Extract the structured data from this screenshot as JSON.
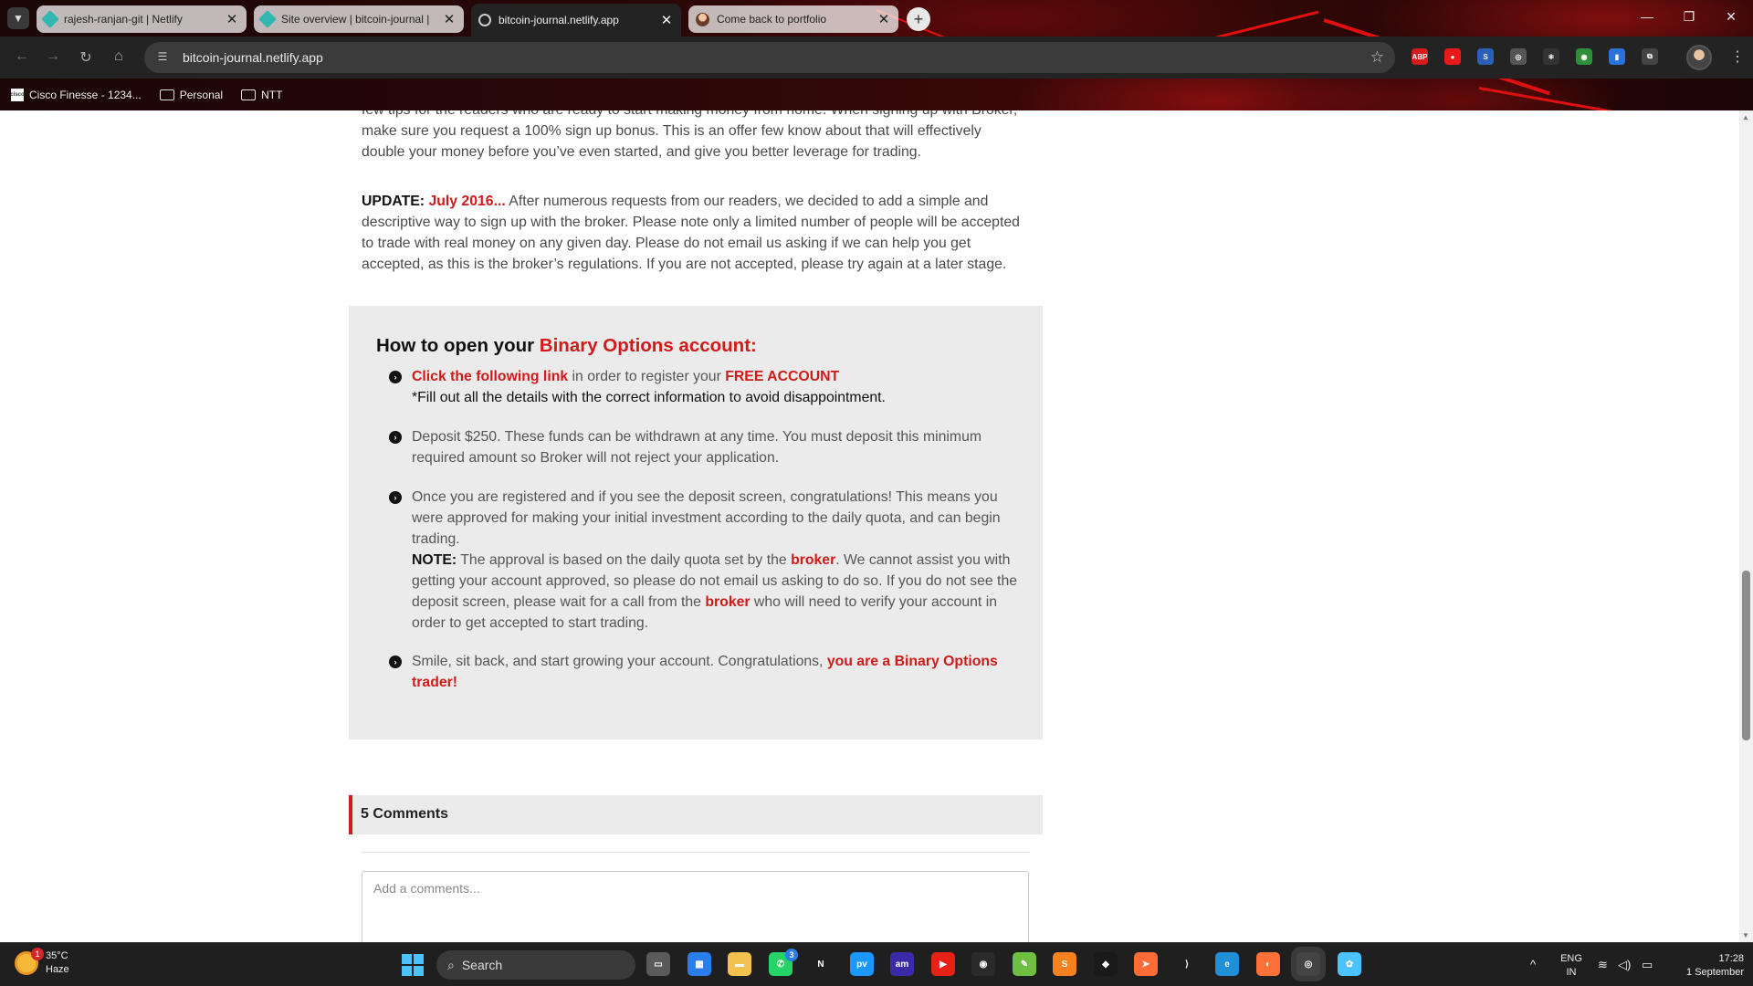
{
  "browser": {
    "tabs": [
      {
        "label": "rajesh-ranjan-git | Netlify",
        "icon": "netlify-icon",
        "active": false
      },
      {
        "label": "Site overview | bitcoin-journal |",
        "icon": "netlify-icon",
        "active": false
      },
      {
        "label": "bitcoin-journal.netlify.app",
        "icon": "globe-icon",
        "active": true
      },
      {
        "label": "Come back to portfolio",
        "icon": "avatar-icon",
        "active": false
      }
    ],
    "close_symbol": "✕",
    "new_tab_symbol": "+",
    "url": "bitcoin-journal.netlify.app",
    "bookmarks": [
      {
        "label": "Cisco Finesse - 1234...",
        "icon": "cisco-icon"
      },
      {
        "label": "Personal",
        "icon": "folder-icon"
      },
      {
        "label": "NTT",
        "icon": "folder-icon"
      }
    ],
    "extensions": [
      {
        "name": "adblock-plus-icon",
        "text": "ABP",
        "color": "#d41c1c"
      },
      {
        "name": "red-shield-icon",
        "text": "●",
        "color": "#e81919"
      },
      {
        "name": "s-extension-icon",
        "text": "S",
        "color": "#2b5fb8"
      },
      {
        "name": "target-extension-icon",
        "text": "◎",
        "color": "#555555"
      },
      {
        "name": "react-devtools-icon",
        "text": "⚛",
        "color": "#333333"
      },
      {
        "name": "green-globe-extension-icon",
        "text": "◉",
        "color": "#2f8f3a"
      },
      {
        "name": "blue-doc-extension-icon",
        "text": "▮",
        "color": "#2a73d9"
      },
      {
        "name": "puzzle-extensions-icon",
        "text": "⧉",
        "color": "#444444"
      }
    ]
  },
  "article": {
    "intro_text": "few tips for the readers who are ready to start making money from home. When signing up with Broker, make sure you request a 100% sign up bonus. This is an offer few know about that will effectively double your money before you’ve even started, and give you better leverage for trading.",
    "update_label": "UPDATE:",
    "update_date": "July 2016...",
    "update_text": "After numerous requests from our readers, we decided to add a simple and descriptive way to sign up with the broker. Please note only a limited number of people will be accepted to trade with real money on any given day. Please do not email us asking if we can help you get accepted, as this is the broker’s regulations. If you are not accepted, please try again at a later stage."
  },
  "how_to": {
    "title_prefix": "How to open your ",
    "title_highlight": "Binary Options account:",
    "steps": [
      {
        "link_text": "Click the following link",
        "text": " in order to register your ",
        "highlight": "FREE ACCOUNT",
        "note": "*Fill out all the details with the correct information to avoid disappointment."
      },
      {
        "text": "Deposit $250. These funds can be withdrawn at any time. You must deposit this minimum required amount so Broker will not reject your application."
      },
      {
        "text": "Once you are registered and if you see the deposit screen, congratulations! This means you were approved for making your initial investment according to the daily quota, and can begin trading.",
        "note_label": "NOTE:",
        "note_text_1": " The approval is based on the daily quota set by the ",
        "broker_1": "broker",
        "note_text_2": ". We cannot assist you with getting your account approved, so please do not email us asking to do so. If you do not see the deposit screen, please wait for a call from the ",
        "broker_2": "broker",
        "note_text_3": " who will need to verify your account in order to get accepted to start trading."
      },
      {
        "text": "Smile, sit back, and start growing your account. Congratulations, ",
        "highlight": "you are a Binary Options trader!"
      }
    ]
  },
  "comments": {
    "heading": "5 Comments",
    "placeholder": "Add a comments..."
  },
  "taskbar": {
    "weather_temp": "35°C",
    "weather_desc": "Haze",
    "weather_badge": "1",
    "search_label": "Search",
    "whatsapp_badge": "3",
    "lang_1": "ENG",
    "lang_2": "IN",
    "time": "17:28",
    "date": "1 September",
    "apps": [
      {
        "name": "task-view-icon",
        "text": "▭",
        "color": "#5a5a5a"
      },
      {
        "name": "microsoft-store-icon",
        "text": "▦",
        "color": "#2b7de9"
      },
      {
        "name": "file-explorer-icon",
        "text": "▬",
        "color": "#f2c14e"
      },
      {
        "name": "whatsapp-icon",
        "text": "✆",
        "color": "#25d366"
      },
      {
        "name": "netflix-icon",
        "text": "N",
        "color": "#1f1f1f"
      },
      {
        "name": "prime-video-icon",
        "text": "pv",
        "color": "#1a98ff"
      },
      {
        "name": "amazon-music-icon",
        "text": "am",
        "color": "#3b2aa8"
      },
      {
        "name": "youtube-icon",
        "text": "▶",
        "color": "#e62117"
      },
      {
        "name": "github-icon",
        "text": "◉",
        "color": "#2a2a2a"
      },
      {
        "name": "notepad-icon",
        "text": "✎",
        "color": "#6fbf40"
      },
      {
        "name": "sublime-text-icon",
        "text": "S",
        "color": "#f58220"
      },
      {
        "name": "mongodb-compass-icon",
        "text": "◆",
        "color": "#1a1a1a"
      },
      {
        "name": "postman-icon",
        "text": "➤",
        "color": "#ff6c37"
      },
      {
        "name": "vscode-icon",
        "text": "⟩",
        "color": "#1f1f1f"
      },
      {
        "name": "edge-icon",
        "text": "e",
        "color": "#1f8fd8"
      },
      {
        "name": "firefox-icon",
        "text": "◐",
        "color": "#ff7139"
      },
      {
        "name": "chrome-icon",
        "text": "◎",
        "color": "#3a3a3a"
      },
      {
        "name": "paint-icon",
        "text": "✿",
        "color": "#4cc2ff"
      }
    ]
  }
}
